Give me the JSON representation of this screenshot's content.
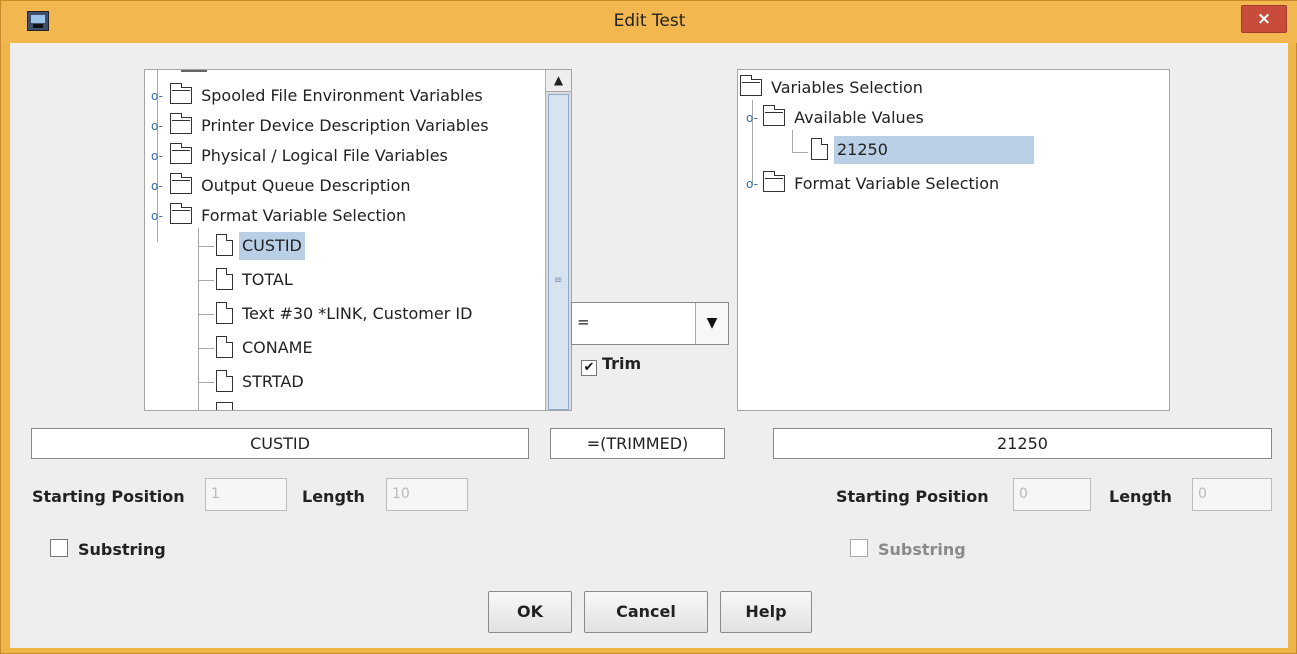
{
  "window": {
    "title": "Edit Test",
    "close_glyph": "×"
  },
  "left_tree": {
    "nodes": [
      {
        "label": "Spooled File Environment Variables",
        "type": "folder"
      },
      {
        "label": "Printer Device Description Variables",
        "type": "folder"
      },
      {
        "label": "Physical / Logical File Variables",
        "type": "folder"
      },
      {
        "label": "Output Queue Description",
        "type": "folder"
      },
      {
        "label": "Format Variable Selection",
        "type": "folder",
        "expanded": true
      },
      {
        "label": "CUSTID",
        "type": "doc",
        "selected": true
      },
      {
        "label": "TOTAL",
        "type": "doc"
      },
      {
        "label": "Text #30 *LINK, Customer ID",
        "type": "doc"
      },
      {
        "label": "CONAME",
        "type": "doc"
      },
      {
        "label": "STRTAD",
        "type": "doc"
      }
    ]
  },
  "right_tree": {
    "root": "Variables Selection",
    "nodes": [
      {
        "label": "Available Values",
        "type": "folder",
        "expanded": true
      },
      {
        "label": "21250",
        "type": "doc",
        "selected": true
      },
      {
        "label": "Format Variable Selection",
        "type": "folder"
      }
    ]
  },
  "operator": {
    "value": "=",
    "trim_label": "Trim",
    "trim_checked": true
  },
  "summary": {
    "left": "CUSTID",
    "operator": "=(TRIMMED)",
    "right": "21250"
  },
  "left_options": {
    "start_label": "Starting Position",
    "start_value": "1",
    "length_label": "Length",
    "length_value": "10",
    "substring_label": "Substring"
  },
  "right_options": {
    "start_label": "Starting Position",
    "start_value": "0",
    "length_label": "Length",
    "length_value": "0",
    "substring_label": "Substring"
  },
  "buttons": {
    "ok": "OK",
    "cancel": "Cancel",
    "help": "Help"
  },
  "icons": [
    "app-icon",
    "close-icon",
    "folder-icon",
    "document-icon",
    "tree-expand-handle-icon",
    "scroll-up-arrow-icon",
    "dropdown-arrow-icon",
    "checkmark-icon"
  ]
}
